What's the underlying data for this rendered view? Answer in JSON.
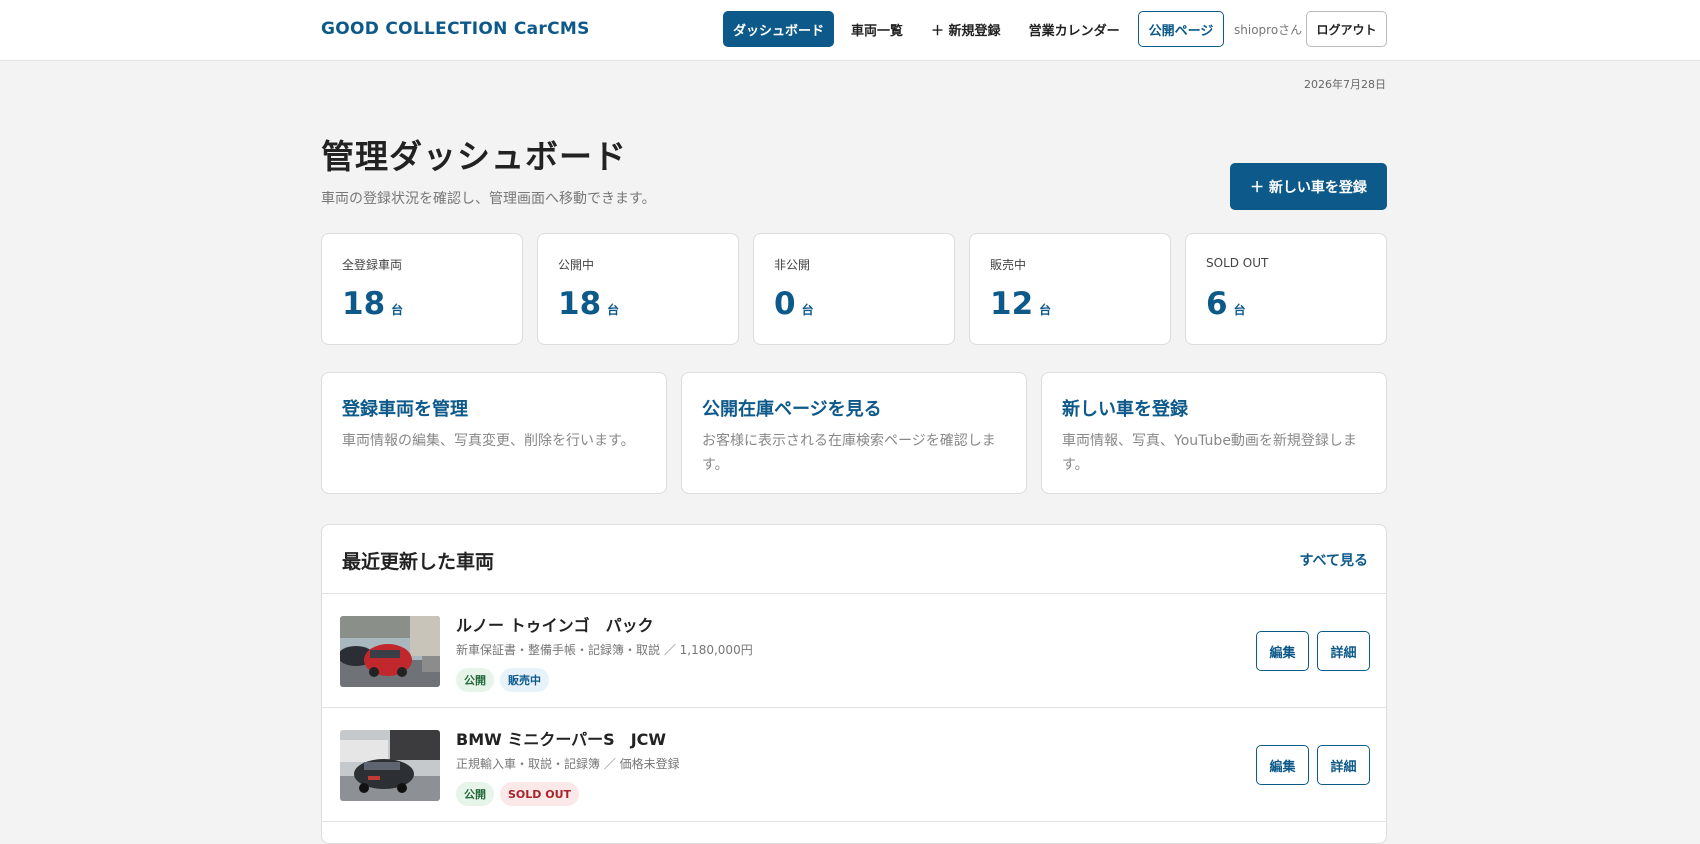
{
  "header": {
    "brand": "GOOD COLLECTION CarCMS",
    "nav": [
      {
        "label": "ダッシュボード"
      },
      {
        "label": "車両一覧"
      },
      {
        "label": "＋ 新規登録"
      },
      {
        "label": "営業カレンダー"
      },
      {
        "label": "公開ページ"
      }
    ],
    "user": "shioproさん",
    "logout": "ログアウト"
  },
  "date": "2026年7月28日",
  "page": {
    "title": "管理ダッシュボード",
    "subtitle": "車両の登録状況を確認し、管理画面へ移動できます。",
    "new_car_button": "＋ 新しい車を登録"
  },
  "stats": [
    {
      "label": "全登録車両",
      "value": "18",
      "unit": "台"
    },
    {
      "label": "公開中",
      "value": "18",
      "unit": "台"
    },
    {
      "label": "非公開",
      "value": "0",
      "unit": "台"
    },
    {
      "label": "販売中",
      "value": "12",
      "unit": "台"
    },
    {
      "label": "SOLD OUT",
      "value": "6",
      "unit": "台"
    }
  ],
  "links": [
    {
      "title": "登録車両を管理",
      "desc": "車両情報の編集、写真変更、削除を行います。"
    },
    {
      "title": "公開在庫ページを見る",
      "desc": "お客様に表示される在庫検索ページを確認します。"
    },
    {
      "title": "新しい車を登録",
      "desc": "車両情報、写真、YouTube動画を新規登録します。"
    }
  ],
  "recent": {
    "title": "最近更新した車両",
    "see_all": "すべて見る",
    "cars": [
      {
        "name": "ルノー トゥインゴ　パック",
        "meta": "新車保証書・整備手帳・記録簿・取説 ／ 1,180,000円",
        "tags": [
          "公開",
          "販売中"
        ],
        "edit": "編集",
        "detail": "詳細"
      },
      {
        "name": "BMW ミニクーパーS　JCW",
        "meta": "正規輸入車・取説・記録簿 ／ 価格未登録",
        "tags": [
          "公開",
          "SOLD OUT"
        ],
        "edit": "編集",
        "detail": "詳細"
      }
    ]
  },
  "colors": {
    "accent": "#0d5a8a",
    "background": "#f3f3f3"
  }
}
